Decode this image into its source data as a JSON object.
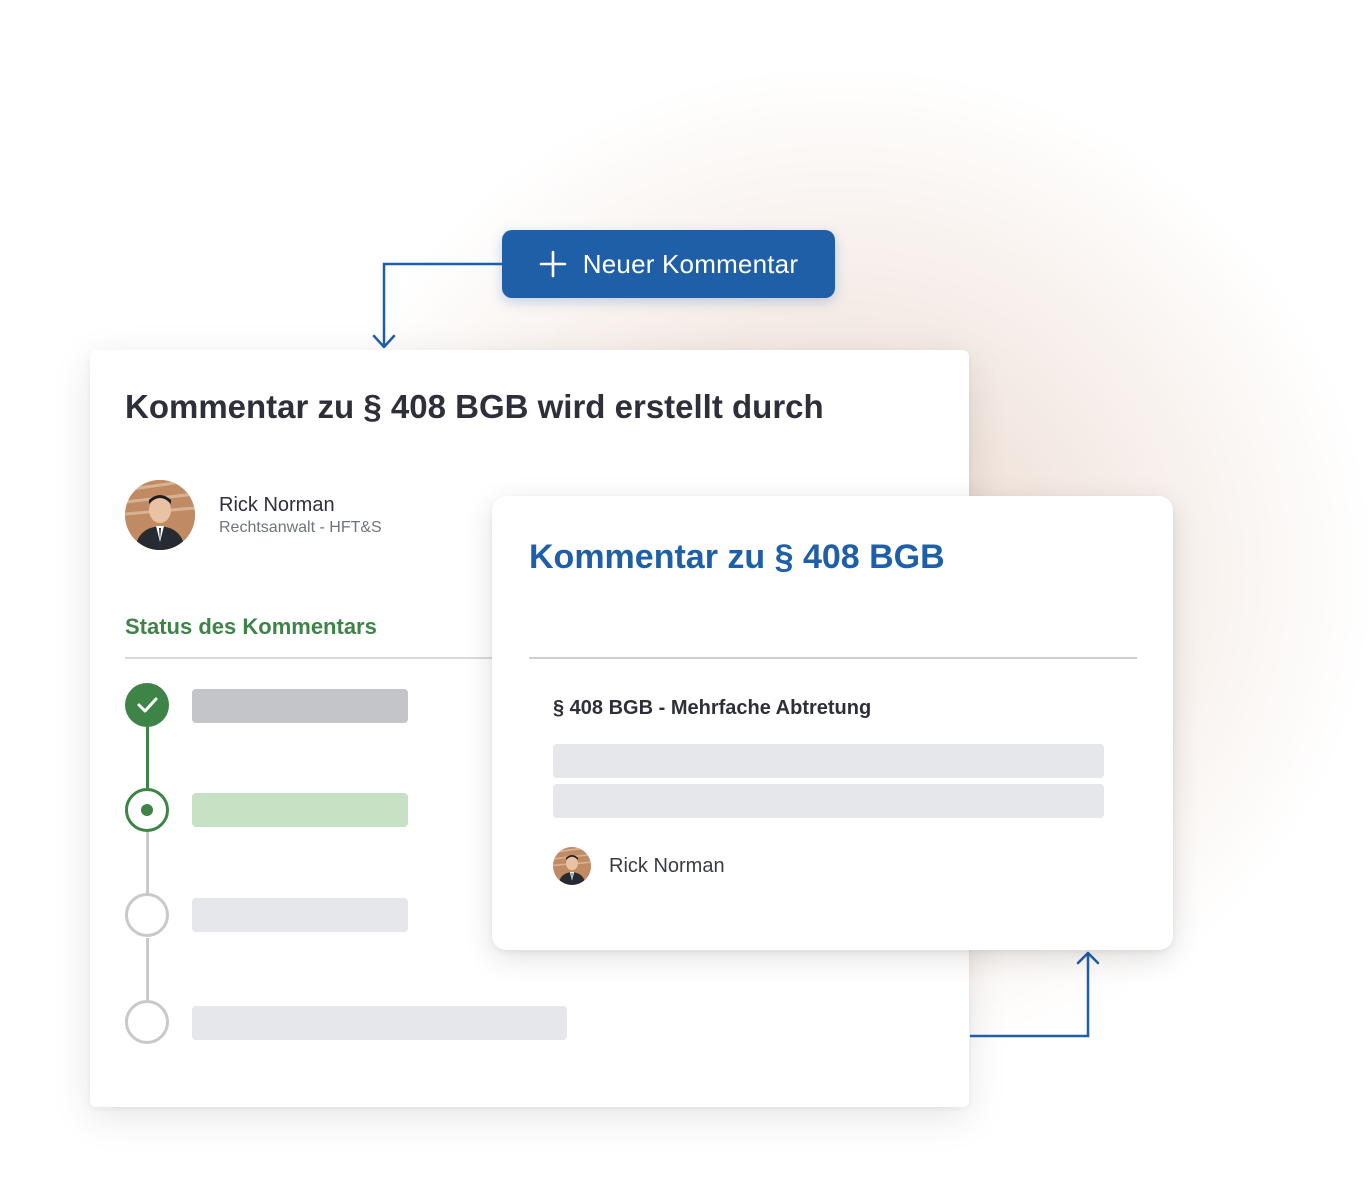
{
  "new_comment_button": {
    "label": "Neuer Kommentar",
    "icon": "plus-icon"
  },
  "creation_card": {
    "title": "Kommentar zu § 408 BGB wird erstellt durch",
    "author": {
      "name": "Rick Norman",
      "role": "Rechtsanwalt - HFT&S"
    },
    "status": {
      "heading": "Status des Kommentars",
      "steps": [
        {
          "state": "done"
        },
        {
          "state": "current"
        },
        {
          "state": "todo"
        },
        {
          "state": "todo"
        }
      ]
    }
  },
  "comment_card": {
    "title": "Kommentar zu § 408 BGB",
    "subheading": "§ 408 BGB - Mehrfache Abtretung",
    "author_name": "Rick Norman"
  },
  "colors": {
    "primary_blue": "#1f5fa8",
    "status_green": "#3f8447",
    "status_green_light": "#c6e1c4",
    "placeholder_gray": "#e6e7ea"
  }
}
